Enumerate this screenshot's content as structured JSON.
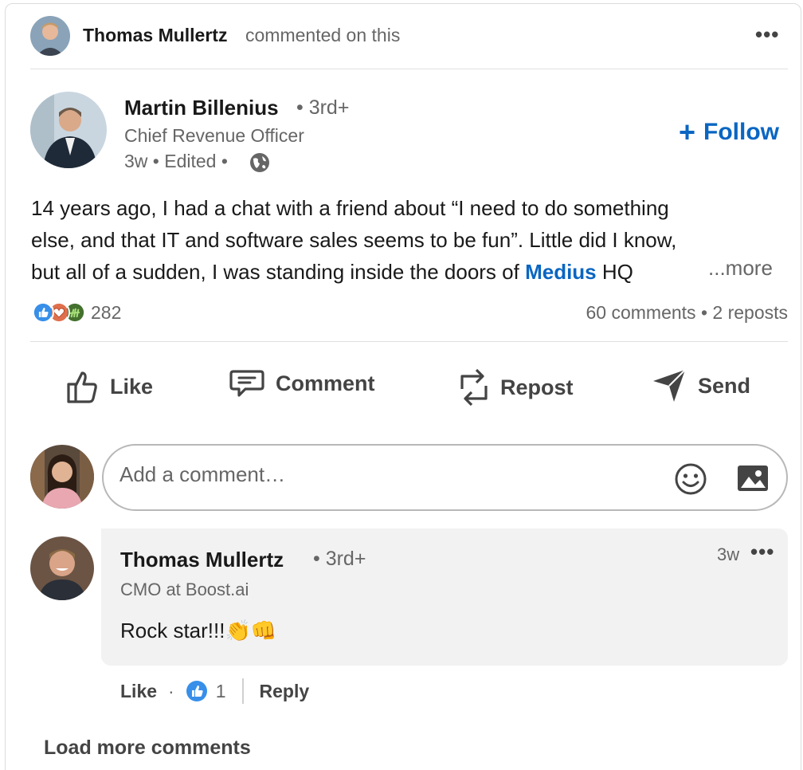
{
  "activity": {
    "name": "Thomas Mullertz",
    "action": "commented on this",
    "more_icon": "•••"
  },
  "post": {
    "author": {
      "name": "Martin Billenius",
      "degree": "• 3rd+",
      "title": "Chief Revenue Officer",
      "meta": "3w • Edited •"
    },
    "follow_label": "Follow",
    "follow_icon": "+",
    "text_lines": [
      "14 years ago, I had a chat with a friend about “I need to do something",
      "else, and that IT and software sales seems to be fun”. Little did I know,",
      "but all of a sudden, I was standing inside the doors of"
    ],
    "mention": "Medius",
    "text_tail": " HQ",
    "more_label": "...more",
    "reaction_count": "282",
    "social_counts": "60 comments • 2 reposts"
  },
  "actions": {
    "like": "Like",
    "comment": "Comment",
    "repost": "Repost",
    "send": "Send"
  },
  "comment_box": {
    "placeholder": "Add a comment…"
  },
  "comment": {
    "name": "Thomas Mullertz",
    "degree": "• 3rd+",
    "time": "3w",
    "more_icon": "•••",
    "headline": "CMO at Boost.ai",
    "text": "Rock star!!!👏👊",
    "like_label": "Like",
    "dot": "·",
    "like_count": "1",
    "reply_label": "Reply"
  },
  "load_more": "Load more comments",
  "colors": {
    "accent": "#0a66c2",
    "text": "#191919",
    "muted": "#666666",
    "bubble": "#f2f2f2"
  }
}
